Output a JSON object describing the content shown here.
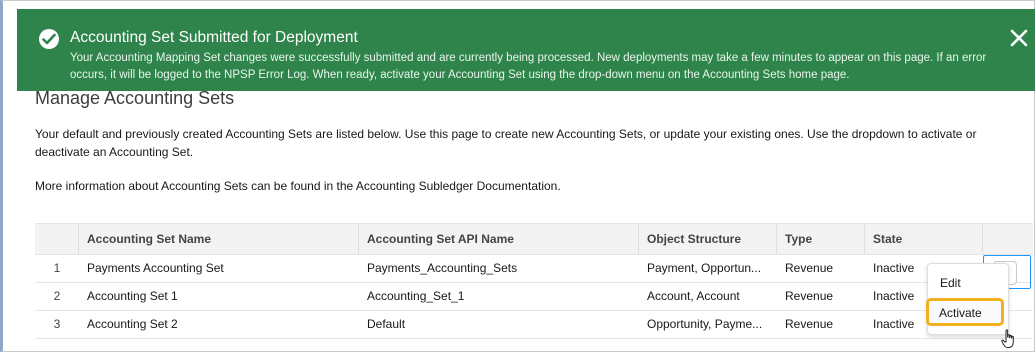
{
  "toast": {
    "icon": "success-check-icon",
    "title": "Accounting Set Submitted for Deployment",
    "message": "Your Accounting Mapping Set changes were successfully submitted and are currently being processed. New deployments may take a few minutes to appear on this page. If an error occurs, it will be logged to the NPSP Error Log. When ready, activate your Accounting Set using the drop-down menu on the Accounting Sets home page.",
    "close_icon": "close-icon",
    "color": "#2e844a"
  },
  "page": {
    "title": "Manage Accounting Sets",
    "description": "Your default and previously created Accounting Sets are listed below. Use this page to create new Accounting Sets, or update your existing ones. Use the dropdown to activate or deactivate an Accounting Set.",
    "more_info": "More information about Accounting Sets can be found in the Accounting Subledger Documentation."
  },
  "table": {
    "headers": [
      "Accounting Set Name",
      "Accounting Set API Name",
      "Object Structure",
      "Type",
      "State"
    ],
    "rows": [
      {
        "num": "1",
        "name": "Payments Accounting Set",
        "api": "Payments_Accounting_Sets",
        "object": "Payment, Opportun...",
        "type": "Revenue",
        "state": "Inactive"
      },
      {
        "num": "2",
        "name": "Accounting Set 1",
        "api": "Accounting_Set_1",
        "object": "Account, Account",
        "type": "Revenue",
        "state": "Inactive"
      },
      {
        "num": "3",
        "name": "Accounting Set 2",
        "api": "Default",
        "object": "Opportunity, Payme...",
        "type": "Revenue",
        "state": "Inactive"
      }
    ]
  },
  "menu": {
    "items": [
      "Edit",
      "Activate"
    ],
    "highlight_color": "#f2b01e"
  }
}
